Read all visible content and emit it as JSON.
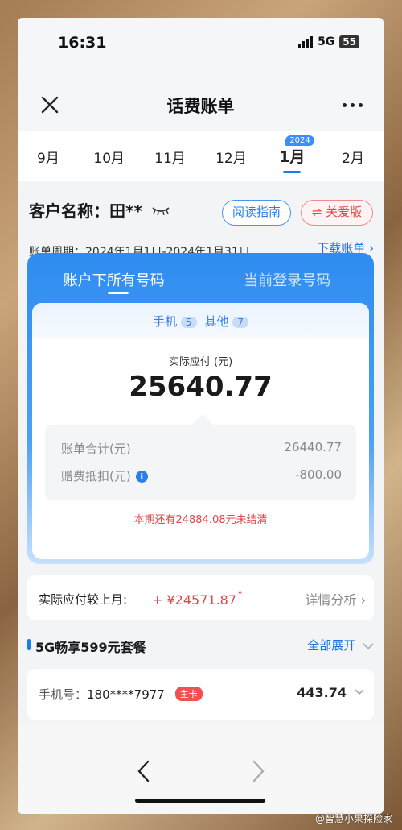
{
  "status": {
    "time": "16:31",
    "network": "5G",
    "battery": "55"
  },
  "nav": {
    "title": "话费账单"
  },
  "months": [
    {
      "label": "9月"
    },
    {
      "label": "10月"
    },
    {
      "label": "11月"
    },
    {
      "label": "12月"
    },
    {
      "label": "1月",
      "badge": "2024",
      "active": true
    },
    {
      "label": "2月"
    }
  ],
  "customer": {
    "name": "客户名称：田**"
  },
  "buttons": {
    "guide": "阅读指南",
    "care": "⇌ 关爱版"
  },
  "period": "账单周期：2024年1月1日-2024年1月31日",
  "download": "下载账单 ›",
  "card": {
    "tab_all": "账户下所有号码",
    "tab_current": "当前登录号码",
    "mobile_label": "手机",
    "mobile_count": "5",
    "other_label": "其他",
    "other_count": "7",
    "due_label": "实际应付 (元)",
    "due_amount": "25640.77",
    "total_label": "账单合计(元)",
    "total_value": "26440.77",
    "deduct_label": "赠费抵扣(元)",
    "deduct_value": "-800.00",
    "unsettled": "本期还有24884.08元未结清"
  },
  "compare": {
    "label": "实际应付较上月:",
    "value": "+ ¥24571.87",
    "detail": "详情分析 ›"
  },
  "package": {
    "name": "5G畅享599元套餐",
    "expand": "全部展开"
  },
  "phone_row": {
    "label": "手机号：",
    "number": "180****7977",
    "badge": "主卡",
    "amount": "443.74"
  },
  "watermark": "@智慧小果探险家",
  "colors": {
    "accent": "#1a7cf0",
    "alert": "#e04848"
  }
}
